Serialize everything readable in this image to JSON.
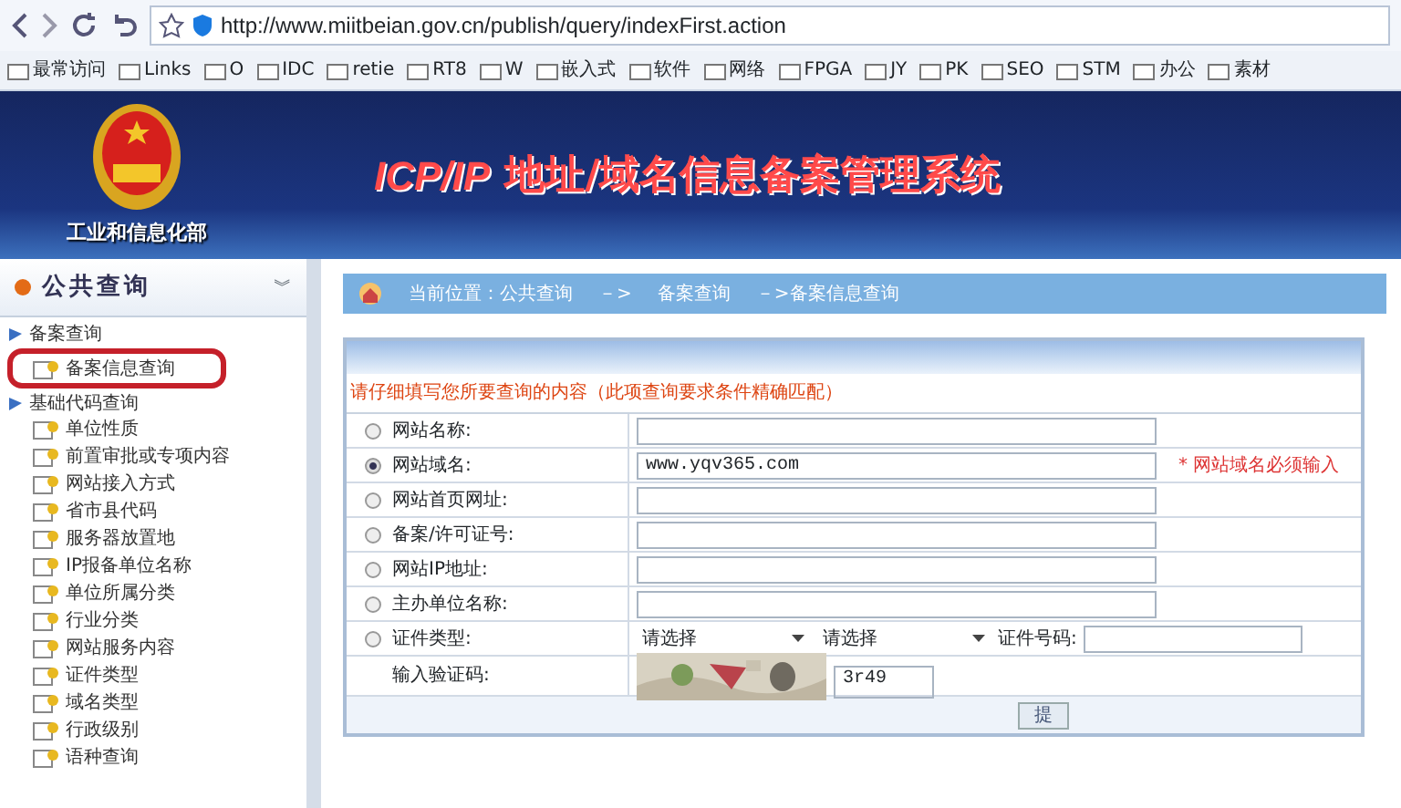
{
  "browser": {
    "address": "http://www.miitbeian.gov.cn/publish/query/indexFirst.action",
    "bookmarks": [
      "最常访问",
      "Links",
      "O",
      "IDC",
      "retie",
      "RT8",
      "W",
      "嵌入式",
      "软件",
      "网络",
      "FPGA",
      "JY",
      "PK",
      "SEO",
      "STM",
      "办公",
      "素材"
    ]
  },
  "header": {
    "ministry": "工业和信息化部",
    "title_latin": "ICP/IP",
    "title": "地址/域名信息备案管理系统"
  },
  "sidebar": {
    "title": "公共查询",
    "collapse_glyph": "︾",
    "groups": [
      {
        "label": "备案查询",
        "children": [
          {
            "label": "备案信息查询",
            "highlighted": true
          }
        ]
      },
      {
        "label": "基础代码查询",
        "children": [
          {
            "label": "单位性质",
            "highlighted": false
          },
          {
            "label": "前置审批或专项内容",
            "highlighted": false
          },
          {
            "label": "网站接入方式",
            "highlighted": false
          },
          {
            "label": "省市县代码",
            "highlighted": false
          },
          {
            "label": "服务器放置地",
            "highlighted": false
          },
          {
            "label": "IP报备单位名称",
            "highlighted": false
          },
          {
            "label": "单位所属分类",
            "highlighted": false
          },
          {
            "label": "行业分类",
            "highlighted": false
          },
          {
            "label": "网站服务内容",
            "highlighted": false
          },
          {
            "label": "证件类型",
            "highlighted": false
          },
          {
            "label": "域名类型",
            "highlighted": false
          },
          {
            "label": "行政级别",
            "highlighted": false
          },
          {
            "label": "语种查询",
            "highlighted": false
          }
        ]
      }
    ]
  },
  "breadcrumb": [
    "当前位置：公共查询",
    "－>",
    "备案查询",
    "－>备案信息查询"
  ],
  "form": {
    "instruction": "请仔细填写您所要查询的内容（此项查询要求条件精确匹配）",
    "rows": [
      {
        "kind": "text",
        "label": "网站名称:",
        "selected": false
      },
      {
        "kind": "text",
        "label": "网站域名:",
        "selected": true,
        "value": "www.yqv365.com",
        "note": "* 网站域名必须输入"
      },
      {
        "kind": "text",
        "label": "网站首页网址:",
        "selected": false
      },
      {
        "kind": "text",
        "label": "备案/许可证号:",
        "selected": false
      },
      {
        "kind": "text",
        "label": "网站IP地址:",
        "selected": false
      },
      {
        "kind": "text",
        "label": "主办单位名称:",
        "selected": false
      },
      {
        "kind": "id",
        "label": "证件类型:",
        "selected": false,
        "select_1": "请选择",
        "select_2": "请选择",
        "number_label": "证件号码:"
      },
      {
        "kind": "captcha",
        "label": "输入验证码:",
        "value": "3r49"
      }
    ],
    "submit": "提"
  }
}
